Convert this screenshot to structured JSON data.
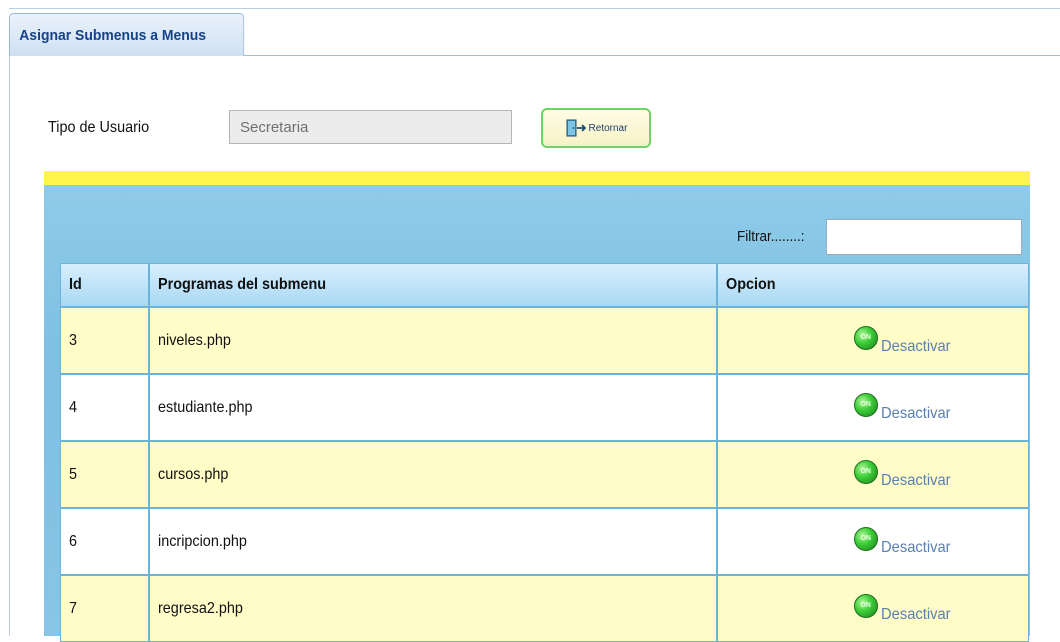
{
  "tab": {
    "title": "Asignar Submenus a Menus"
  },
  "form": {
    "user_type_label": "Tipo de Usuario",
    "user_type_value": "Secretaria",
    "return_button_label": "Retornar",
    "return_icon": "door-exit-icon"
  },
  "filter": {
    "label": "Filtrar........:",
    "value": ""
  },
  "table": {
    "headers": {
      "id": "Id",
      "program": "Programas del submenu",
      "option": "Opcion"
    },
    "rows": [
      {
        "id": "3",
        "program": "niveles.php",
        "action": "Desactivar",
        "status_icon": "on-icon"
      },
      {
        "id": "4",
        "program": "estudiante.php",
        "action": "Desactivar",
        "status_icon": "on-icon"
      },
      {
        "id": "5",
        "program": "cursos.php",
        "action": "Desactivar",
        "status_icon": "on-icon"
      },
      {
        "id": "6",
        "program": "incripcion.php",
        "action": "Desactivar",
        "status_icon": "on-icon"
      },
      {
        "id": "7",
        "program": "regresa2.php",
        "action": "Desactivar",
        "status_icon": "on-icon"
      }
    ]
  },
  "colors": {
    "tab_text": "#15428b",
    "highlight_strip": "#fff44a",
    "panel": "#8fcbe9",
    "odd_row": "#fffcc8",
    "link": "#5a7fb3"
  }
}
